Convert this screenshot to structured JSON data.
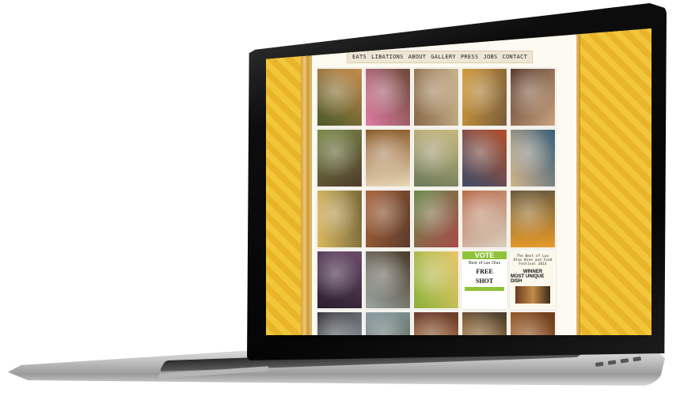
{
  "nav": {
    "items": [
      "EATS",
      "LIBATIONS",
      "ABOUT",
      "GALLERY",
      "PRESS",
      "JOBS",
      "CONTACT"
    ]
  },
  "gallery": {
    "tiles": [
      {
        "kind": "photo",
        "colors": [
          "#4b5a2a",
          "#c58a4a"
        ]
      },
      {
        "kind": "photo",
        "colors": [
          "#e07aa3",
          "#6b4a3a"
        ]
      },
      {
        "kind": "photo",
        "colors": [
          "#8a6a48",
          "#c9b38d"
        ]
      },
      {
        "kind": "photo",
        "colors": [
          "#d19a3a",
          "#7a5d3a"
        ]
      },
      {
        "kind": "photo",
        "colors": [
          "#5a3b2b",
          "#c9a380"
        ]
      },
      {
        "kind": "photo",
        "colors": [
          "#7a8a4a",
          "#4e3b2a"
        ]
      },
      {
        "kind": "photo",
        "colors": [
          "#8a5a2a",
          "#e7d6b6"
        ]
      },
      {
        "kind": "photo",
        "colors": [
          "#c9b880",
          "#6d7a5a"
        ]
      },
      {
        "kind": "photo",
        "colors": [
          "#b24e2a",
          "#3e4d6a"
        ]
      },
      {
        "kind": "photo",
        "colors": [
          "#3a5e7a",
          "#d3b48a"
        ]
      },
      {
        "kind": "photo",
        "colors": [
          "#7a6a3a",
          "#d9b860"
        ]
      },
      {
        "kind": "photo",
        "colors": [
          "#5a3a2a",
          "#a8643a"
        ]
      },
      {
        "kind": "photo",
        "colors": [
          "#a84a4a",
          "#6a8a4a"
        ]
      },
      {
        "kind": "photo",
        "colors": [
          "#d9d0c0",
          "#b86a4a"
        ]
      },
      {
        "kind": "photo",
        "colors": [
          "#e69a2a",
          "#6a5a3a"
        ]
      },
      {
        "kind": "photo",
        "colors": [
          "#2a1e2e",
          "#6a4a6a"
        ]
      },
      {
        "kind": "photo",
        "colors": [
          "#9aa5a0",
          "#4a3a2a"
        ]
      },
      {
        "kind": "photo",
        "colors": [
          "#8ab23a",
          "#e8c66a"
        ]
      },
      {
        "kind": "vote"
      },
      {
        "kind": "fest"
      },
      {
        "kind": "photo",
        "colors": [
          "#3a3a3a",
          "#9aa0b0"
        ]
      },
      {
        "kind": "photo",
        "colors": [
          "#8a9aa5",
          "#4a5a3a"
        ]
      },
      {
        "kind": "photo",
        "colors": [
          "#6a3a2a",
          "#c98a4a"
        ]
      },
      {
        "kind": "photo",
        "colors": [
          "#4a3a2a",
          "#d8a050"
        ]
      },
      {
        "kind": "photo",
        "colors": [
          "#6a3a1a",
          "#c07a3a"
        ]
      }
    ]
  },
  "vote_tile": {
    "title": "VOTE",
    "subtitle": "Best of Las Olas",
    "line1": "FREE",
    "line2": "SHOT"
  },
  "fest_tile": {
    "caption": "The Best of Las Olas Wine and Food Festival 2014",
    "winner": "WINNER",
    "award": "MOST UNIQUE DISH"
  }
}
